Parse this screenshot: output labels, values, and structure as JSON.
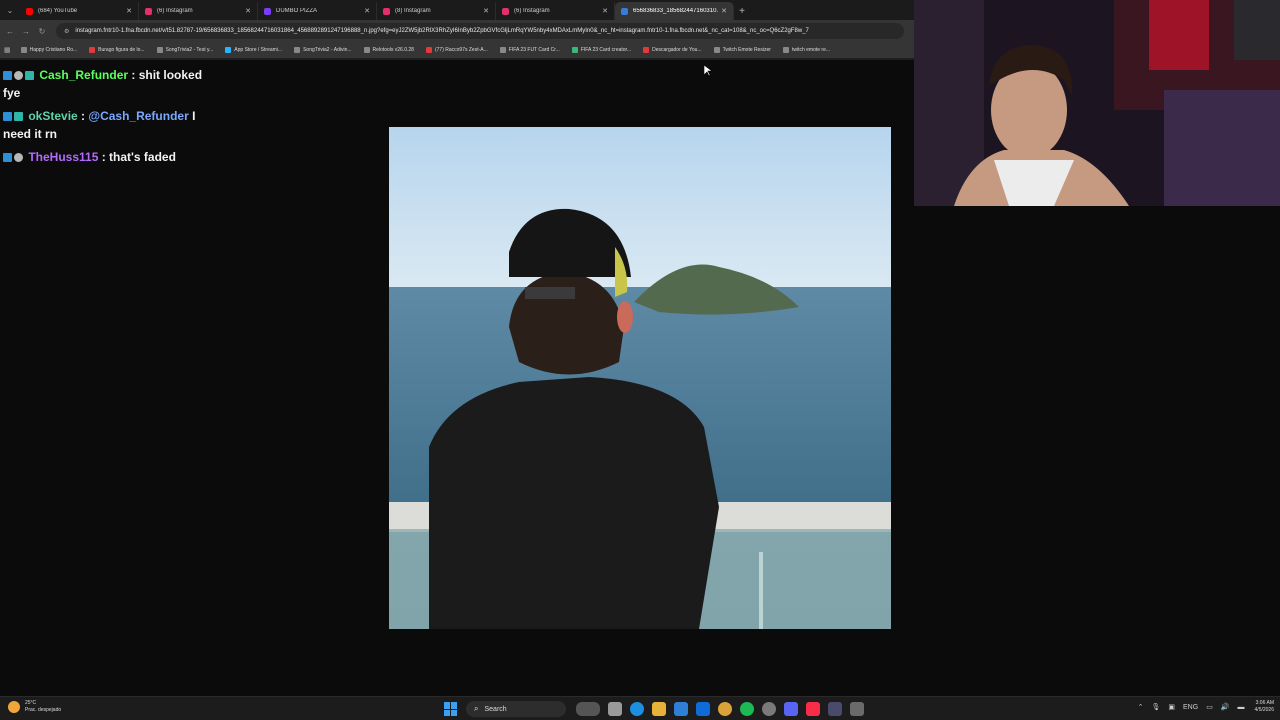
{
  "browser": {
    "tabs": [
      {
        "label": "(684) YouTube",
        "color": "#ff0000"
      },
      {
        "label": "(6) Instagram",
        "color": "#e1306c"
      },
      {
        "label": "DUMBO PIZZA",
        "color": "#7a3cff"
      },
      {
        "label": "(8) Instagram",
        "color": "#e1306c"
      },
      {
        "label": "(6) Instagram",
        "color": "#e1306c"
      },
      {
        "label": "656836833_185682447160310...",
        "color": "#3a7bd5",
        "active": true
      }
    ],
    "new_tab": "+",
    "tab_dropdown": "⌄",
    "url": "instagram.fntr10-1.fna.fbcdn.net/v/t51.82787-19/656836833_18568244716031864_4568892891247196888_n.jpg?efg=eyJ2ZW5jb2RlX3RhZyI6InByb2ZpbGVfcGljLmRqYW5nby4xMDAxLmMyIn0&_nc_ht=instagram.fntr10-1.fna.fbcdn.net&_nc_cat=108&_nc_oc=Q6cZ2gF8w_7",
    "bookmarks": [
      "Happy Cristiano Ro...",
      "Burago figura de lo...",
      "SongTrivia2 - Test y...",
      "App Store / Streami...",
      "SongTrivia2 - Adivin...",
      "Relotools v26.0.28",
      "(77) Racco97s Zest-A...",
      "FIFA 23 FUT Card Cr...",
      "FIFA 23 Card creator...",
      "Descargador de You...",
      "Twitch Emote Resizer",
      "twitch emote re..."
    ]
  },
  "chat": [
    {
      "user": "Cash_Refunder",
      "color": "#5dff5d",
      "text": " : shit looked fye"
    },
    {
      "user": "okStevie",
      "color": "#5fd3a8",
      "mention": "@Cash_Refunder",
      "mention_color": "#7aa8ff",
      "text": " I need it rn"
    },
    {
      "user": "TheHuss115",
      "color": "#b36bff",
      "text": " : that's faded"
    }
  ],
  "taskbar": {
    "temp": "25°C",
    "condition": "Prac. despejado",
    "search_label": "Search",
    "lang": "ENG",
    "time": "3:06 AM",
    "date": "4/5/2026"
  }
}
